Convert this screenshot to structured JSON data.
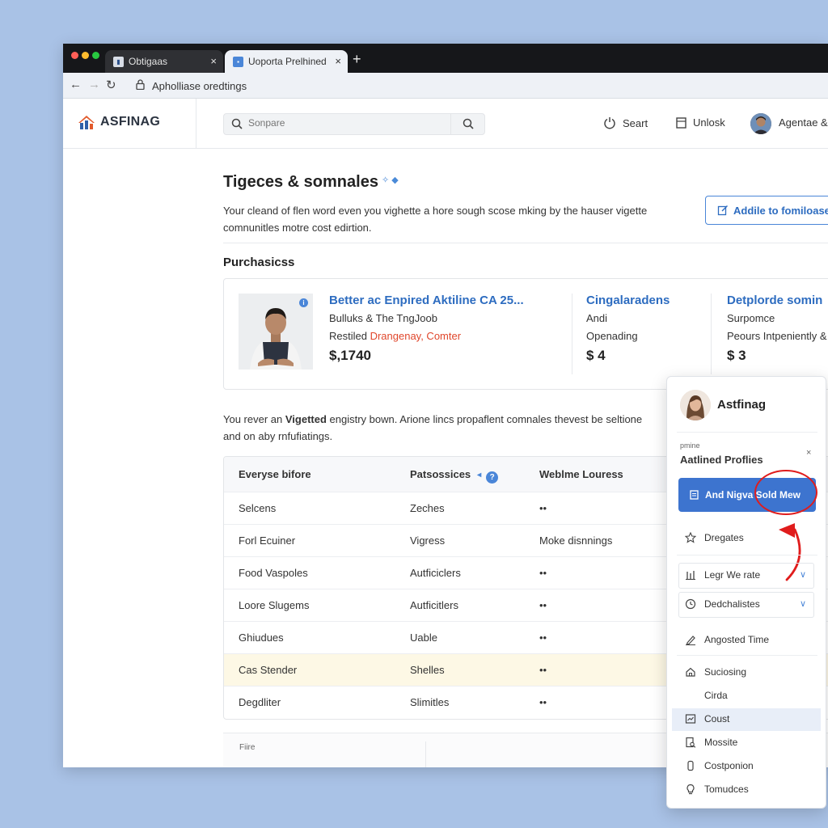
{
  "browser": {
    "tabs": [
      {
        "label": "Obtigaas"
      },
      {
        "label": "Uoporta Prelhined"
      }
    ],
    "new_tab": "+",
    "close_glyph": "×",
    "address": "Apholliase oredtings"
  },
  "header": {
    "logo_text": "ASFINAG",
    "search_placeholder": "Sonpare",
    "items": {
      "start": "Seart",
      "unlock": "Unlosk"
    },
    "user_name": "Agentae &"
  },
  "main": {
    "title": "Tigeces & somnales",
    "title_sparkle": "✧ ◆",
    "intro_lines": [
      "Your cleand of flen word even you vighette a hore sough scose mking by the hauser vigette",
      "comnunitles motre cost edirtion."
    ],
    "add_button": "Addile to fomiloase",
    "purchases_title": "Purchasicss",
    "purchases": [
      {
        "title": "Better ac Enpired Aktiline CA 25...",
        "line1": "Bulluks & The TngJoob",
        "line2_prefix": "Restiled ",
        "line2_highlight": "Drangenay, Comter",
        "price": "$,1740"
      },
      {
        "title": "Cingalaradens",
        "line1": "Andi",
        "line2": "Openading",
        "price": "$ 4"
      },
      {
        "title": "Detplorde somin",
        "line1": "Surpomce",
        "line2": "Peours Intpeniently &",
        "price": "$ 3"
      }
    ],
    "note_prefix": "You rever an ",
    "note_bold": "Vigetted",
    "note_rest": " engistry bown. Arione lincs propaflent comnales thevest be seltione",
    "note_line2": "and on aby rnfufiatings.",
    "table": {
      "columns": [
        "Everyse bifore",
        "Patsossices",
        "Weblme Louress"
      ],
      "rows": [
        [
          "Selcens",
          "Zeches",
          "••"
        ],
        [
          "Forl Ecuiner",
          "Vigress",
          "Moke disnnings"
        ],
        [
          "Food Vaspoles",
          "Autficiclers",
          "••"
        ],
        [
          "Loore Slugems",
          "Autficitlers",
          "••"
        ],
        [
          "Ghiudues",
          "Uable",
          "••"
        ],
        [
          "Cas Stender",
          "Shelles",
          "••"
        ],
        [
          "Degdliter",
          "Slimitles",
          "••"
        ]
      ],
      "highlighted_row": 5
    },
    "footer_label": "Fiire"
  },
  "panel": {
    "name": "Astfinag",
    "tiny_label": "pmine",
    "title": "Aatlined Proflies",
    "close": "×",
    "primary_button": "And Nigva Sold Mew",
    "items": {
      "dregates": "Dregates",
      "legr": "Legr We rate",
      "dedch": "Dedchalistes",
      "angosted": "Angosted Time",
      "sucios": "Suciosing",
      "cirda": "Cirda",
      "coust": "Coust",
      "mossite": "Mossite",
      "costpo": "Costponion",
      "tomuces": "Tomudces"
    },
    "chevron": "∨"
  },
  "colors": {
    "accent": "#3d74cf",
    "link": "#2d6cc0",
    "annotation": "#e01c1c",
    "background": "#a9c2e6"
  }
}
